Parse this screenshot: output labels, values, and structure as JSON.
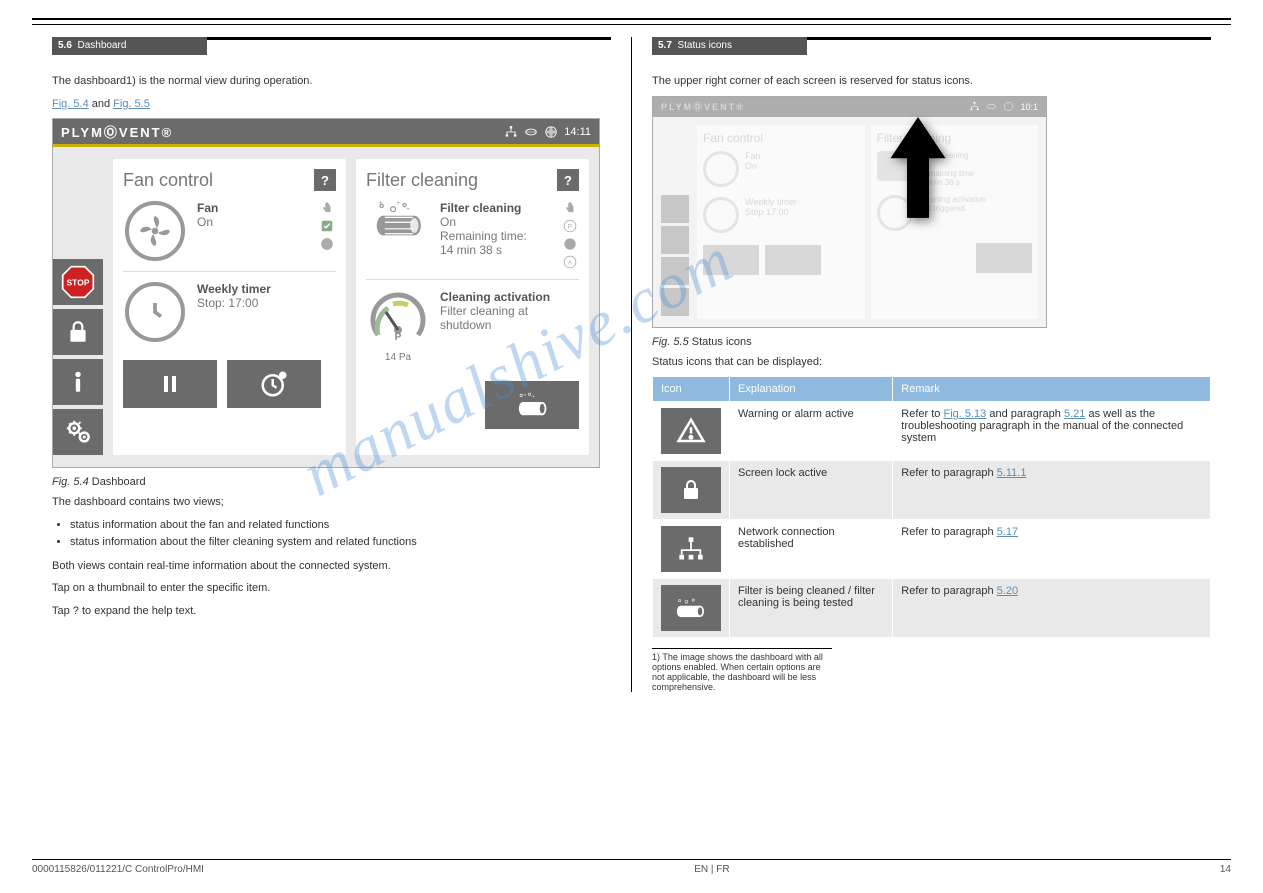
{
  "footer": {
    "doc": "0000115826/011221/C ControlPro/HMI",
    "lang": "EN | FR",
    "page": "14"
  },
  "left": {
    "section_no": "5.6",
    "section_title": "Dashboard",
    "intro": "The dashboard1) is the normal view during operation.",
    "fig_link_a": "Fig. 5.4",
    "fig_link_b": "Fig. 5.5",
    "fig_connector": " and ",
    "fig_caption_no": "Fig. 5.4",
    "fig_caption": "  Dashboard",
    "p_views": "The dashboard contains two views;",
    "views": [
      "status information about the fan and related functions",
      "status information about the filter cleaning system and related functions"
    ],
    "p_both": "Both views contain real-time information about the connected system.",
    "p_tap1": "Tap on a thumbnail to enter the specific item.",
    "p_tap2": "Tap   ?   to expand the help text.",
    "footnote": "1) The image shows the dashboard with all options enabled. When certain options are not applicable, the dashboard will be less comprehensive."
  },
  "hmi": {
    "brand": "PLYMⓄVENT®",
    "time": "14:11",
    "fan_panel": {
      "title": "Fan control",
      "help": "?",
      "fan_label": "Fan",
      "fan_value": "On",
      "timer_label": "Weekly timer",
      "timer_value": "Stop: 17:00"
    },
    "filter_panel": {
      "title": "Filter cleaning",
      "help": "?",
      "fc_label": "Filter cleaning",
      "fc_value_on": "On",
      "fc_value_remain_lbl": "Remaining time:",
      "fc_value_remain": "14 min 38 s",
      "ca_label": "Cleaning activation",
      "ca_value1": "Filter cleaning at",
      "ca_value2": "shutdown",
      "gauge": "14 Pa"
    }
  },
  "right": {
    "section_no": "5.7",
    "section_title": "Status icons",
    "intro": "The upper right corner of each screen is reserved for status icons.",
    "fig_caption_no": "Fig. 5.5",
    "fig_caption": "  Status icons",
    "p_icons": "Status icons that can be displayed:",
    "table": {
      "headers": [
        "Icon",
        "Explanation",
        "Remark"
      ],
      "rows": [
        {
          "icon": "warning",
          "explanation": "Warning or alarm active",
          "remark_pre": "Refer to ",
          "remark_link1": "Fig. 5.13",
          "remark_mid": " and paragraph ",
          "remark_link2": "5.21",
          "remark_plain": " as well as the troubleshooting paragraph in the manual of the connected system"
        },
        {
          "icon": "lock",
          "explanation": "Screen lock active",
          "remark_pre": "Refer to paragraph ",
          "remark_link1": "5.11.1"
        },
        {
          "icon": "network",
          "explanation": "Network connection established",
          "remark_pre": "Refer to paragraph ",
          "remark_link1": "5.17"
        },
        {
          "icon": "cleaning",
          "explanation": "Filter is being cleaned / filter cleaning is being tested",
          "remark_pre": "Refer to paragraph ",
          "remark_link1": "5.20"
        }
      ]
    }
  },
  "hmi_small": {
    "time": "10:1"
  },
  "watermark": "manualshive.com"
}
